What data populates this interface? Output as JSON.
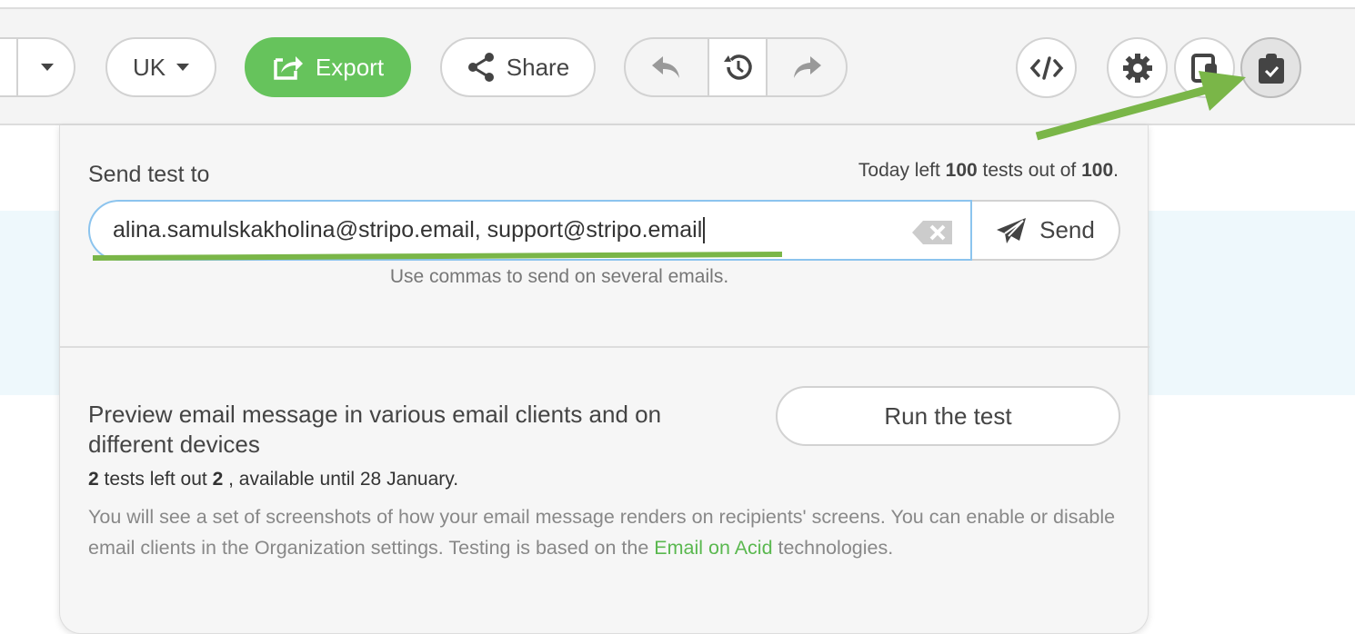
{
  "toolbar": {
    "language": "UK",
    "export_label": "Export",
    "share_label": "Share"
  },
  "popup": {
    "send_title": "Send test to",
    "quota_prefix": "Today left ",
    "quota_left": "100",
    "quota_mid": " tests out of ",
    "quota_total": "100",
    "quota_suffix": ".",
    "email_value": "alina.samulskakholina@stripo.email, support@stripo.email",
    "send_label": "Send",
    "hint": "Use commas to send on several emails.",
    "preview_title": "Preview email message in various email clients and on different devices",
    "run_label": "Run the test",
    "tests_left": "2",
    "tests_mid": " tests left out ",
    "tests_total": "2",
    "tests_suffix": " , available until 28 January.",
    "description": "You will see a set of screenshots of how your email message renders on recipients' screens. You can enable or disable email clients in the Organization settings. Testing is based on the ",
    "link": "Email on Acid",
    "description_end": " technologies."
  },
  "colors": {
    "accent": "#66c35c",
    "annotation": "#7ab648"
  }
}
